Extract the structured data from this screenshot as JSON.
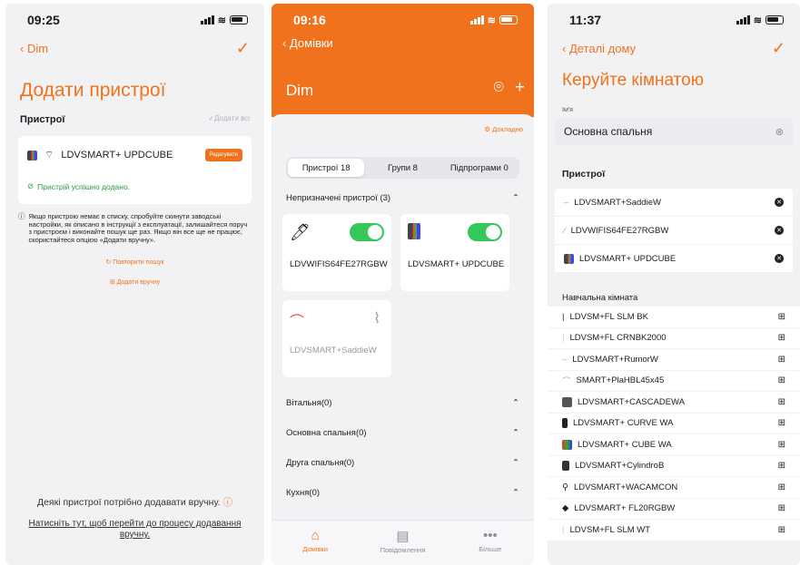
{
  "panel1": {
    "time": "09:25",
    "back_label": "Dim",
    "title": "Додати пристрої",
    "section": "Пристрої",
    "add_all": "Додати всі",
    "device": "LDVSMART+ UPDCUBE",
    "edit": "Редагувати",
    "success": "Пристрій успішно додано.",
    "info": "Якщо пристрою немає в списку, спробуйте скинути заводські настройки, як описано в інструкції з експлуатації, залишайтеся поруч з пристроєм і виконайте пошук ще раз. Якщо він все ще не працює, скористайтеся опцією «Додати вручну».",
    "retry": "Повторити пошук",
    "manual": "Додати вручну",
    "note": "Деякі пристрої потрібно додавати вручну.",
    "link": "Натисніть тут, щоб перейти до процесу додавання вручну."
  },
  "panel2": {
    "time": "09:16",
    "back_label": "Домівки",
    "home": "Dim",
    "details": "Докладно",
    "tabs": [
      "Пристрої 18",
      "Групи 8",
      "Підпрограми 0"
    ],
    "unassigned": "Непризначені пристрої (3)",
    "cards": [
      "LDVWIFIS64FE27RGBW",
      "LDVSMART+ UPDCUBE",
      "LDVSMART+SaddieW"
    ],
    "rooms": [
      "Вітальня(0)",
      "Основна спальня(0)",
      "Друга спальня(0)",
      "Кухня(0)"
    ],
    "tabbar": [
      "Домівки",
      "Повідомлення",
      "Більше"
    ]
  },
  "panel3": {
    "time": "11:37",
    "back_label": "Деталі дому",
    "title": "Керуйте кімнатою",
    "name_label": "Ім'я",
    "name_value": "Основна спальня",
    "devices_title": "Пристрої",
    "devices": [
      "LDVSMART+SaddieW",
      "LDVWIFIS64FE27RGBW",
      "LDVSMART+ UPDCUBE"
    ],
    "other_room": "Навчальна кімната",
    "available": [
      "LDVSM+FL SLM BK",
      "LDVSM+FL CRNBK2000",
      "LDVSMART+RumorW",
      "SMART+PlaHBL45x45",
      "LDVSMART+CASCADEWA",
      "LDVSMART+ CURVE WA",
      "LDVSMART+ CUBE WA",
      "LDVSMART+CylindroB",
      "LDVSMART+WACAMCON",
      "LDVSMART+ FL20RGBW",
      "LDVSM+FL SLM WT"
    ]
  },
  "colors": {
    "accent": "#f0721c",
    "success": "#2c9a48",
    "toggle": "#34c759"
  }
}
